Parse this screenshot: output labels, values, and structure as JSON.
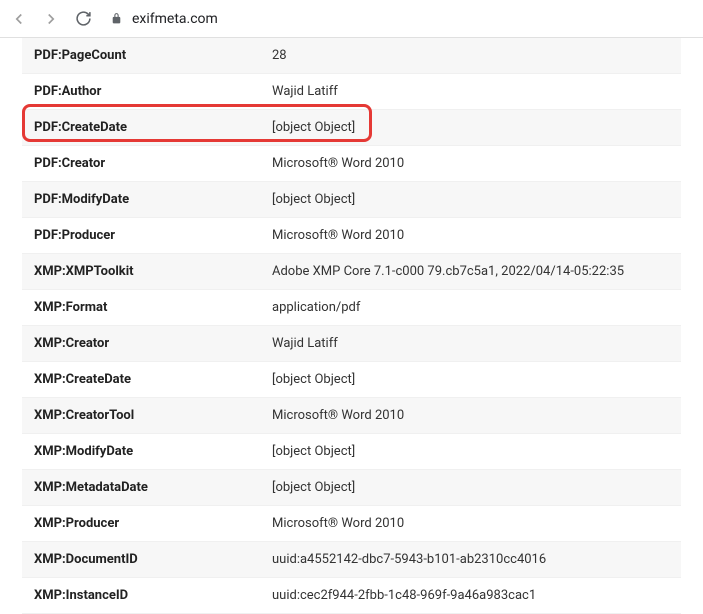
{
  "browser": {
    "url": "exifmeta.com"
  },
  "rows": [
    {
      "key": "PDF:PageCount",
      "value": "28"
    },
    {
      "key": "PDF:Author",
      "value": "Wajid Latiff"
    },
    {
      "key": "PDF:CreateDate",
      "value": "[object Object]"
    },
    {
      "key": "PDF:Creator",
      "value": "Microsoft® Word 2010"
    },
    {
      "key": "PDF:ModifyDate",
      "value": "[object Object]"
    },
    {
      "key": "PDF:Producer",
      "value": "Microsoft® Word 2010"
    },
    {
      "key": "XMP:XMPToolkit",
      "value": "Adobe XMP Core 7.1-c000 79.cb7c5a1, 2022/04/14-05:22:35"
    },
    {
      "key": "XMP:Format",
      "value": "application/pdf"
    },
    {
      "key": "XMP:Creator",
      "value": "Wajid Latiff"
    },
    {
      "key": "XMP:CreateDate",
      "value": "[object Object]"
    },
    {
      "key": "XMP:CreatorTool",
      "value": "Microsoft® Word 2010"
    },
    {
      "key": "XMP:ModifyDate",
      "value": "[object Object]"
    },
    {
      "key": "XMP:MetadataDate",
      "value": "[object Object]"
    },
    {
      "key": "XMP:Producer",
      "value": "Microsoft® Word 2010"
    },
    {
      "key": "XMP:DocumentID",
      "value": "uuid:a4552142-dbc7-5943-b101-ab2310cc4016"
    },
    {
      "key": "XMP:InstanceID",
      "value": "uuid:cec2f944-2fbb-1c48-969f-9a46a983cac1"
    }
  ]
}
